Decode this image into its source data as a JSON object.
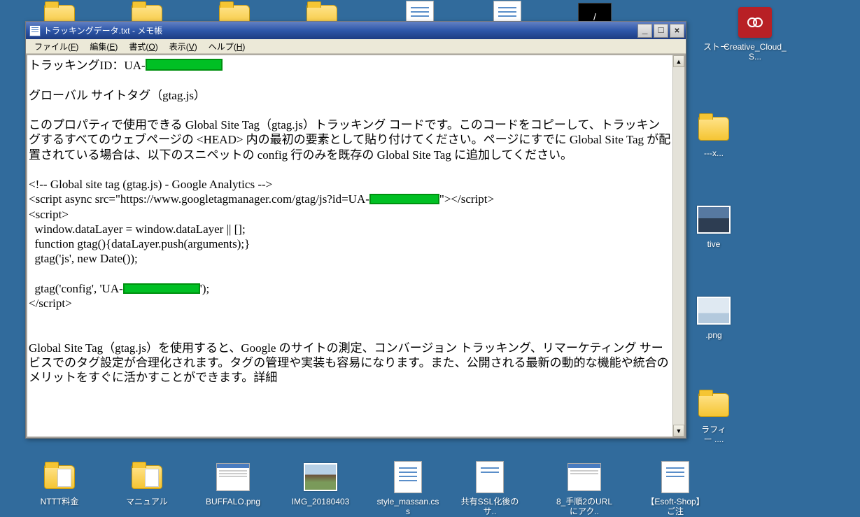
{
  "window": {
    "title": "トラッキングデータ.txt - メモ帳",
    "menus": {
      "file": "ファイル(F)",
      "edit": "編集(E)",
      "format": "書式(O)",
      "view": "表示(V)",
      "help": "ヘルプ(H)"
    }
  },
  "content": {
    "l1a": "トラッキングID：UA-",
    "l2": "グローバル サイトタグ（gtag.js）",
    "l3": "このプロパティで使用できる Global Site Tag（gtag.js）トラッキング コードです。このコードをコピーして、トラッキングするすべてのウェブページの <HEAD> 内の最初の要素として貼り付けてください。ページにすでに Global Site Tag が配置されている場合は、以下のスニペットの config 行のみを既存の Global Site Tag に追加してください。",
    "c1": "<!-- Global site tag (gtag.js) - Google Analytics -->",
    "c2a": "<script async src=\"https://www.googletagmanager.com/gtag/js?id=UA-",
    "c2b": "\"></script>",
    "c3": "<script>",
    "c4": "  window.dataLayer = window.dataLayer || [];",
    "c5": "  function gtag(){dataLayer.push(arguments);}",
    "c6": "  gtag('js', new Date());",
    "c7a": "  gtag('config', 'UA-",
    "c7b": "');",
    "c8": "</script>",
    "l4": "Global Site Tag（gtag.js）を使用すると、Google のサイトの測定、コンバージョン トラッキング、リマーケティング サービスでのタグ設定が合理化されます。タグの管理や実装も容易になります。また、公開される最新の動的な機能や統合のメリットをすぐに活かすことができます。詳細"
  },
  "sb": {
    "up": "▲",
    "down": "▼"
  },
  "icons": {
    "i1": "ストー",
    "i2": "Creative_Cloud_S...",
    "i3": "---x...",
    "i4": "tive",
    "i5": ".png",
    "i6": "ラフィ\nー ....",
    "b1": "NTTT料金",
    "b2": "マニュアル",
    "b3": "BUFFALO.png",
    "b4": "IMG_20180403",
    "b5": "style_massan.css",
    "b6": "共有SSL化後のサ..",
    "b7": "8_手順2のURLにアク..",
    "b8": "【Esoft-Shop】ご注"
  }
}
